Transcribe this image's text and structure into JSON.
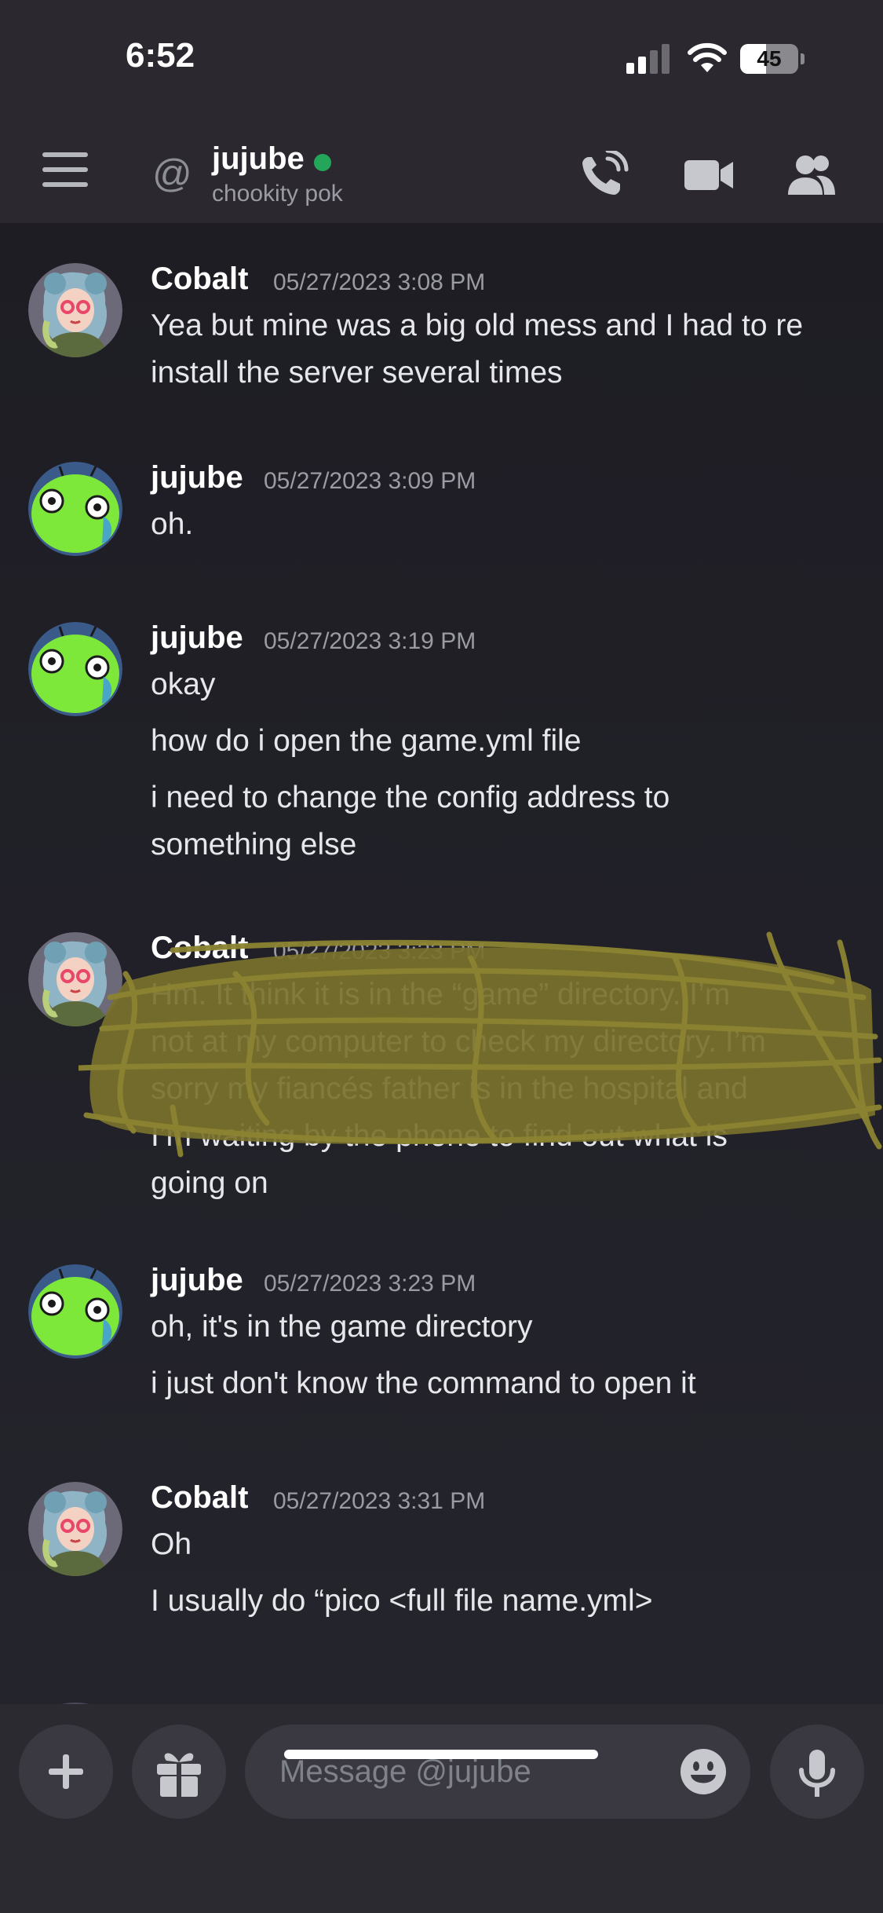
{
  "status_bar": {
    "time": "6:52",
    "battery": "45",
    "battery_level": 0.45
  },
  "header": {
    "name": "jujube",
    "status": "chookity pok",
    "online": true
  },
  "messages": [
    {
      "author": "Cobalt",
      "timestamp": "05/27/2023 3:08 PM",
      "avatar": "cobalt-avatar",
      "lines": [
        "Yea but mine was a big old mess and I had to re",
        "install the server several times"
      ]
    },
    {
      "author": "jujube",
      "timestamp": "05/27/2023 3:09 PM",
      "avatar": "jujube-avatar",
      "lines": [
        "oh."
      ]
    },
    {
      "author": "jujube",
      "timestamp": "05/27/2023 3:19 PM",
      "avatar": "jujube-avatar",
      "lines": [
        "okay",
        "how do i open the game.yml file",
        "i need to change the config address to",
        "something else"
      ]
    },
    {
      "author": "Cobalt",
      "timestamp": "05/27/2023 3:23 PM",
      "avatar": "cobalt-avatar",
      "lines": [
        "Hm. It think it is in the “game” directory. I’m",
        "not at my computer to check my directory. I’m",
        "sorry my fiancés father is in the hospital and",
        "I’m waiting by the phone to find out what is",
        "going on"
      ]
    },
    {
      "author": "jujube",
      "timestamp": "05/27/2023 3:23 PM",
      "avatar": "jujube-avatar",
      "lines": [
        "oh, it's in the game directory",
        "i just don't know the command to open it"
      ]
    },
    {
      "author": "Cobalt",
      "timestamp": "05/27/2023 3:31 PM",
      "avatar": "cobalt-avatar",
      "lines": [
        "Oh",
        "I usually do “pico <full file name.yml>"
      ]
    }
  ],
  "composer": {
    "placeholder": "Message @jujube"
  },
  "colors": {
    "scribble": "#79722b",
    "online": "#23a55a"
  }
}
